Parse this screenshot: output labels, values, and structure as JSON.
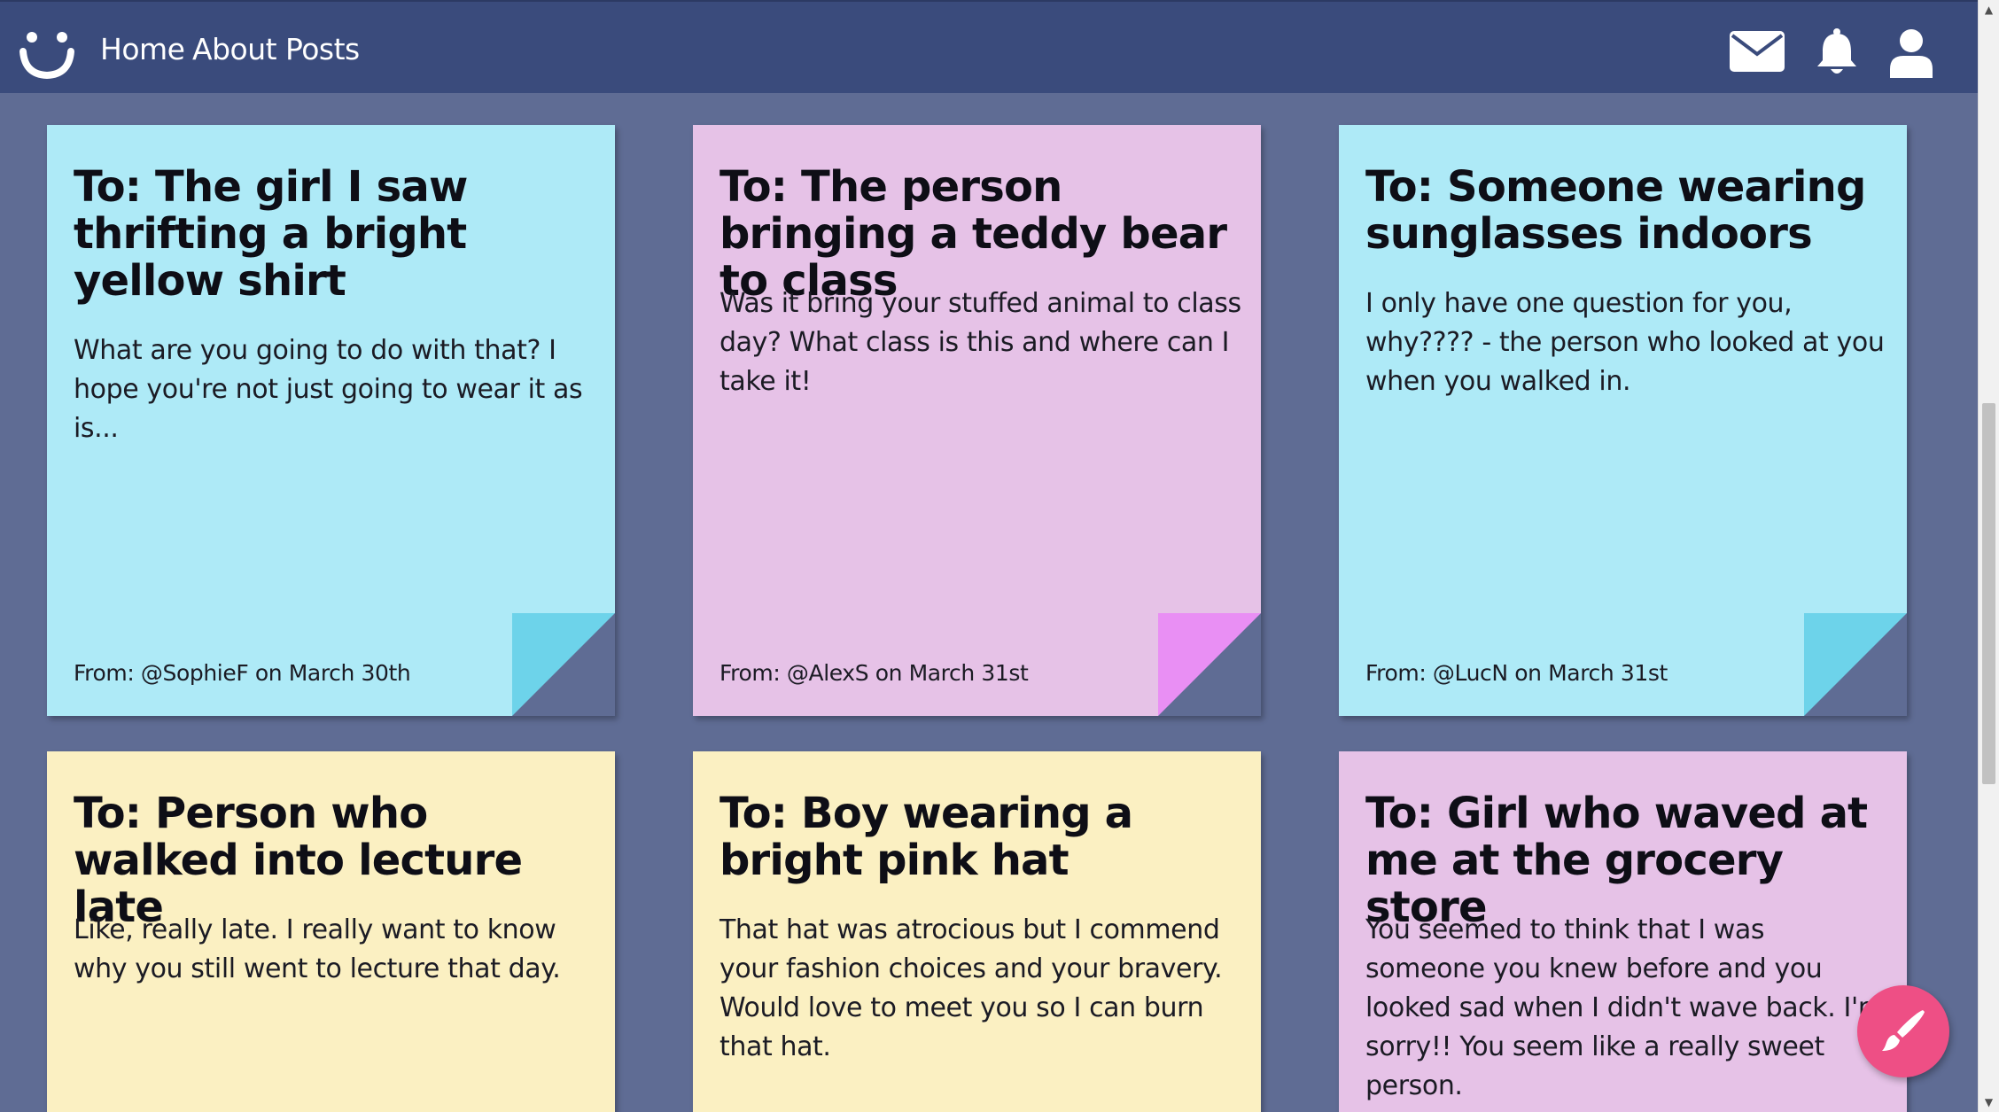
{
  "navbar": {
    "logo_icon": "smiley-logo-icon",
    "links": [
      {
        "label": "Home"
      },
      {
        "label": "About"
      },
      {
        "label": "Posts"
      }
    ],
    "icons": [
      "mail-icon",
      "bell-icon",
      "user-icon"
    ]
  },
  "notes": [
    {
      "title": "To: The girl I saw thrifting a bright yellow shirt",
      "body": "What are you going to do with that? I hope you're not just going to wear it as is...",
      "from": "From: @SophieF on March 30th",
      "color": "#aeeaf7",
      "fold_color": "#6dd3ea"
    },
    {
      "title": "To: The person bringing a teddy bear to class",
      "body": "Was it bring your stuffed animal to class day? What class is this and where can I take it!",
      "from": "From: @AlexS on March 31st",
      "color": "#e6c2e7",
      "fold_color": "#e98ff4"
    },
    {
      "title": "To: Someone wearing sunglasses indoors",
      "body": "I only have one question for you, why???? - the person who looked at you when you walked in.",
      "from": "From: @LucN on March 31st",
      "color": "#aeeaf7",
      "fold_color": "#6dd3ea"
    },
    {
      "title": "To: Person who walked into lecture late",
      "body": "Like, really late. I really want to know why you still went to lecture that day.",
      "color": "#fbf0c2"
    },
    {
      "title": "To: Boy wearing a bright pink hat",
      "body": "That hat was atrocious but I commend your fashion choices and your bravery. Would love to meet you so I can burn that hat.",
      "color": "#fbf0c2"
    },
    {
      "title": "To: Girl who waved at me at the grocery store",
      "body": "You seemed to think that I was someone you knew before and you looked sad when I didn't wave back. I'm sorry!! You seem like a really sweet person.",
      "color": "#e6c2e7"
    }
  ],
  "fab": {
    "icon": "paintbrush-icon",
    "color": "#ee4f85"
  },
  "colors": {
    "navbar": "#3a4b7c",
    "background": "#5f6c94"
  }
}
